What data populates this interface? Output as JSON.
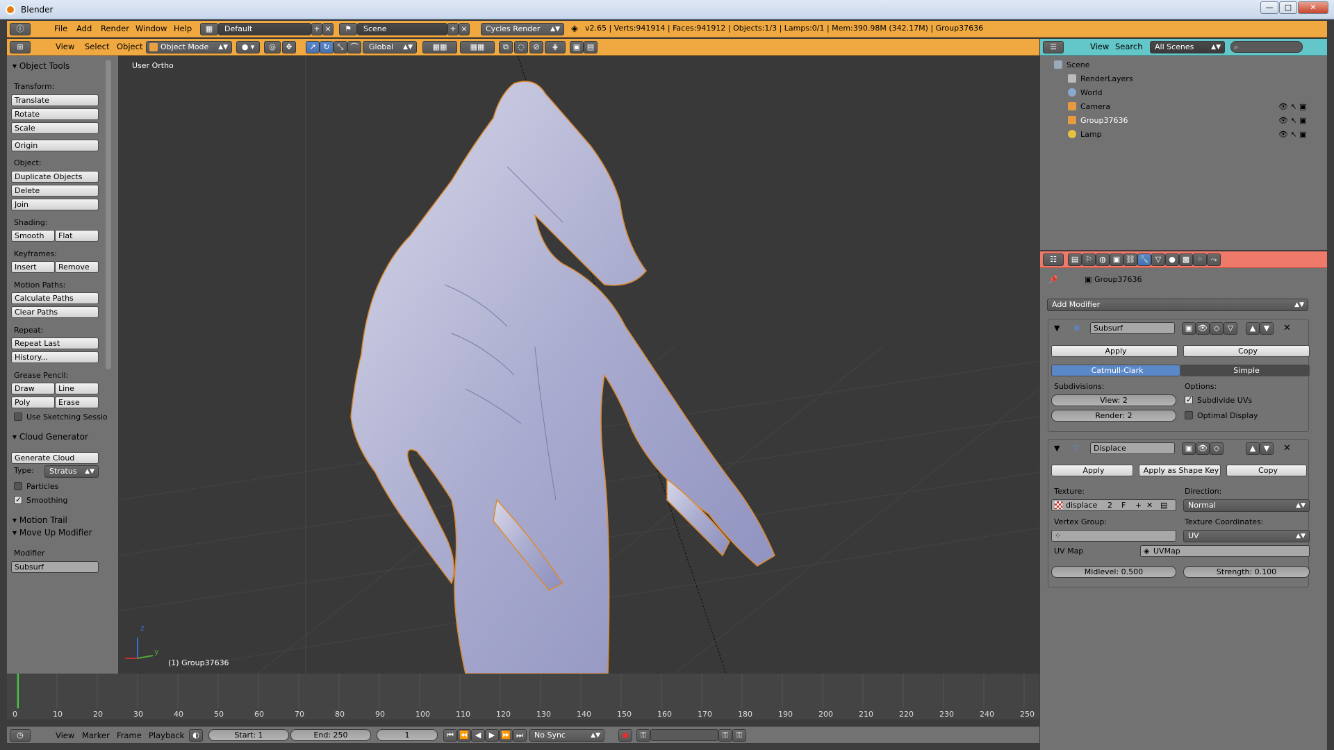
{
  "window": {
    "title": "Blender",
    "minimize": "—",
    "maximize": "□",
    "close": "✕"
  },
  "info_header": {
    "menus": [
      "File",
      "Add",
      "Render",
      "Window",
      "Help"
    ],
    "screen_layout": "Default",
    "scene": "Scene",
    "render_engine": "Cycles Render",
    "stats": "v2.65 | Verts:941914 | Faces:941912 | Objects:1/3 | Lamps:0/1 | Mem:390.98M (342.17M) | Group37636"
  },
  "view3d_header": {
    "menus": [
      "View",
      "Select",
      "Object"
    ],
    "mode": "Object Mode",
    "orientation": "Global"
  },
  "tool_shelf": {
    "title": "Object Tools",
    "transform_label": "Transform:",
    "translate": "Translate",
    "rotate": "Rotate",
    "scale": "Scale",
    "origin": "Origin",
    "object_label": "Object:",
    "duplicate": "Duplicate Objects",
    "delete": "Delete",
    "join": "Join",
    "shading_label": "Shading:",
    "smooth": "Smooth",
    "flat": "Flat",
    "keyframes_label": "Keyframes:",
    "insert": "Insert",
    "remove": "Remove",
    "motion_paths_label": "Motion Paths:",
    "calculate_paths": "Calculate Paths",
    "clear_paths": "Clear Paths",
    "repeat_label": "Repeat:",
    "repeat_last": "Repeat Last",
    "history": "History...",
    "grease_label": "Grease Pencil:",
    "draw": "Draw",
    "line": "Line",
    "poly": "Poly",
    "erase": "Erase",
    "use_sketching": "Use Sketching Sessio",
    "cloud_title": "Cloud Generator",
    "generate_cloud": "Generate Cloud",
    "type_label": "Type:",
    "type_value": "Stratus",
    "particles": "Particles",
    "smoothing": "Smoothing",
    "motion_trail": "Motion Trail",
    "move_up_modifier": "Move Up Modifier",
    "modifier_label": "Modifier",
    "modifier_value": "Subsurf"
  },
  "viewport": {
    "view_label": "User Ortho",
    "object_label": "(1) Group37636",
    "axis_y": "y",
    "axis_z": "z"
  },
  "outliner": {
    "menus": [
      "View",
      "Search"
    ],
    "filter": "All Scenes",
    "items": [
      "Scene",
      "RenderLayers",
      "World",
      "Camera",
      "Group37636",
      "Lamp"
    ]
  },
  "properties": {
    "object_name": "Group37636",
    "add_modifier": "Add Modifier",
    "subsurf": {
      "name": "Subsurf",
      "apply": "Apply",
      "copy": "Copy",
      "catmull": "Catmull-Clark",
      "simple": "Simple",
      "subdivisions_label": "Subdivisions:",
      "view": "View: 2",
      "render": "Render: 2",
      "options_label": "Options:",
      "subdivide_uvs": "Subdivide UVs",
      "optimal_display": "Optimal Display"
    },
    "displace": {
      "name": "Displace",
      "apply": "Apply",
      "apply_shape": "Apply as Shape Key",
      "copy": "Copy",
      "texture_label": "Texture:",
      "texture_value": "displace",
      "texture_users": "2",
      "texture_fake": "F",
      "direction_label": "Direction:",
      "direction_value": "Normal",
      "vertex_group_label": "Vertex Group:",
      "texcoords_label": "Texture Coordinates:",
      "texcoords_value": "UV",
      "uvmap_label": "UV Map",
      "uvmap_value": "UVMap",
      "midlevel": "Midlevel: 0.500",
      "strength": "Strength: 0.100"
    }
  },
  "timeline": {
    "ticks": [
      "0",
      "10",
      "20",
      "30",
      "40",
      "50",
      "60",
      "70",
      "80",
      "90",
      "100",
      "110",
      "120",
      "130",
      "140",
      "150",
      "160",
      "170",
      "180",
      "190",
      "200",
      "210",
      "220",
      "230",
      "240",
      "250"
    ],
    "menus": [
      "View",
      "Marker",
      "Frame",
      "Playback"
    ],
    "start": "Start: 1",
    "end": "End: 250",
    "current": "1",
    "sync": "No Sync"
  }
}
